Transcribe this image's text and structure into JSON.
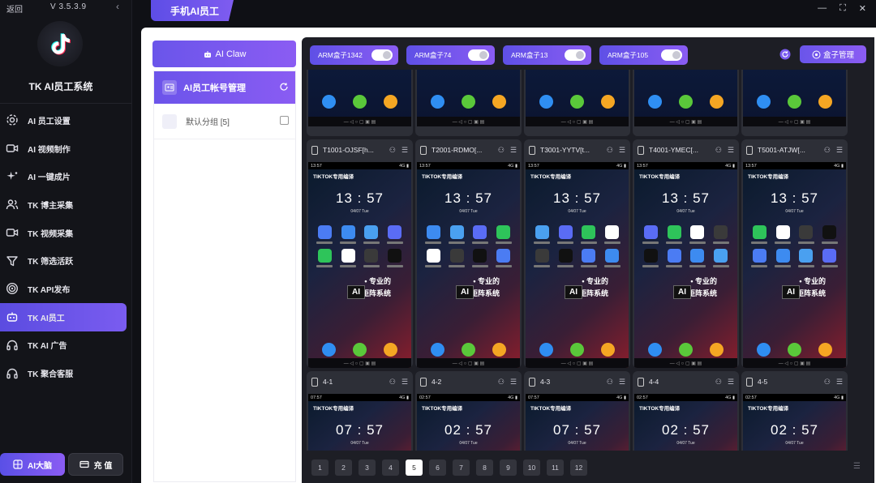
{
  "sidebar": {
    "back": "返回",
    "version": "V 3.5.3.9",
    "title": "TK AI员工系统",
    "items": [
      {
        "label": "AI 员工设置",
        "icon": "gear-icon"
      },
      {
        "label": "AI 视频制作",
        "icon": "video-icon"
      },
      {
        "label": "AI 一键成片",
        "icon": "sparkle-icon"
      },
      {
        "label": "TK 博主采集",
        "icon": "users-icon"
      },
      {
        "label": "TK 视频采集",
        "icon": "video-icon"
      },
      {
        "label": "TK 筛选活跃",
        "icon": "filter-icon"
      },
      {
        "label": "TK API发布",
        "icon": "target-icon"
      },
      {
        "label": "TK AI员工",
        "icon": "robot-icon",
        "active": true
      },
      {
        "label": "TK AI 广告",
        "icon": "headset-icon"
      },
      {
        "label": "TK 聚合客服",
        "icon": "headset-icon"
      }
    ],
    "brain_button": "AI大脑",
    "charge_button": "充 值"
  },
  "header": {
    "tab": "手机AI员工"
  },
  "left_panel": {
    "ai_claw": "AI Claw",
    "account_title": "AI员工帐号管理",
    "group_label": "默认分组 [5]"
  },
  "toolbar": {
    "boxes": [
      "ARM盒子1342",
      "ARM盒子74",
      "ARM盒子13",
      "ARM盒子105"
    ],
    "box_manage": "盒子管理"
  },
  "phones": [
    {
      "title": "T1001-OJSF[h..."
    },
    {
      "title": "T2001-RDMO[..."
    },
    {
      "title": "T3001-YYTV[t..."
    },
    {
      "title": "T4001-YMEC[..."
    },
    {
      "title": "T5001-ATJW[..."
    }
  ],
  "phone_time": "13 : 57",
  "phone_date": "04/07  Tue",
  "banner": "TIKTOK专用编译",
  "promo_line1": "• 专业的",
  "promo_line2": "矩阵系统",
  "promo_ai": "AI",
  "bottom_phones": [
    {
      "title": "4-1",
      "time": "07 : 57"
    },
    {
      "title": "4-2",
      "time": "02 : 57"
    },
    {
      "title": "4-3",
      "time": "07 : 57"
    },
    {
      "title": "4-4",
      "time": "02 : 57"
    },
    {
      "title": "4-5",
      "time": "02 : 57"
    }
  ],
  "pagination": [
    "1",
    "2",
    "3",
    "4",
    "5",
    "6",
    "7",
    "8",
    "9",
    "10",
    "11",
    "12"
  ],
  "active_page": "5"
}
